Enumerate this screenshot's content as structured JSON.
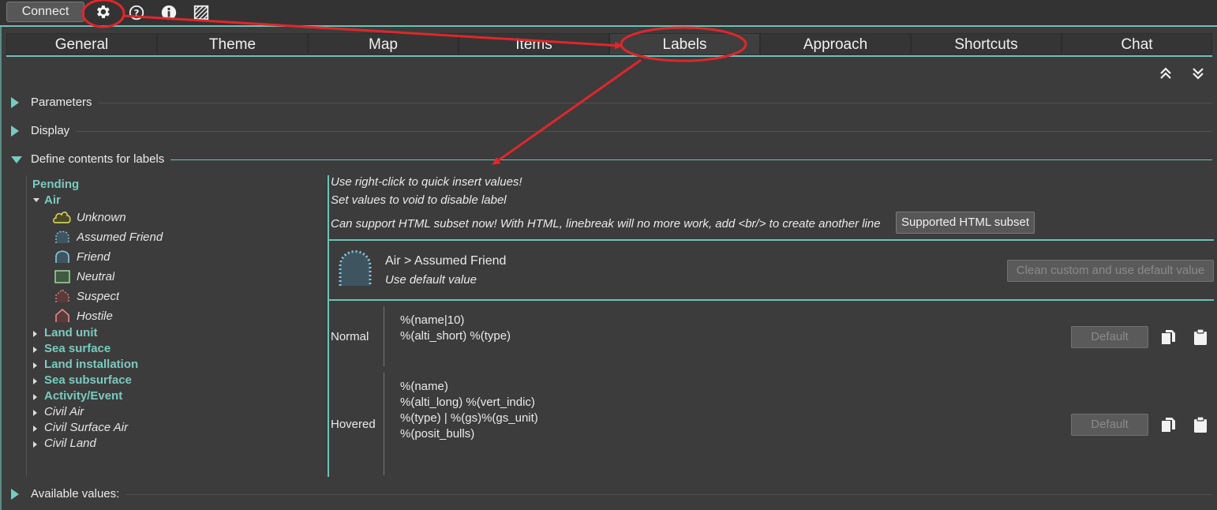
{
  "topbar": {
    "connect_label": "Connect",
    "icons": [
      "settings-gear-icon",
      "help-icon",
      "info-icon",
      "hatch-pattern-icon"
    ]
  },
  "tabs": [
    {
      "label": "General"
    },
    {
      "label": "Theme"
    },
    {
      "label": "Map"
    },
    {
      "label": "Items"
    },
    {
      "label": "Labels",
      "active": true
    },
    {
      "label": "Approach"
    },
    {
      "label": "Shortcuts"
    },
    {
      "label": "Chat"
    }
  ],
  "sections": {
    "parameters": "Parameters",
    "display": "Display",
    "define_contents": "Define contents for labels",
    "available_values": "Available values:"
  },
  "tree": {
    "pending": "Pending",
    "air": "Air",
    "air_items": [
      "Unknown",
      "Assumed Friend",
      "Friend",
      "Neutral",
      "Suspect",
      "Hostile"
    ],
    "categories": [
      "Land unit",
      "Sea surface",
      "Land installation",
      "Sea subsurface",
      "Activity/Event",
      "Civil Air",
      "Civil Surface Air",
      "Civil Land"
    ]
  },
  "panel": {
    "note1": "Use right-click to quick insert values!",
    "note2": "Set values to void to disable label",
    "note3": "Can support HTML subset now! With HTML, linebreak will no more work, add <br/> to create another line",
    "html_subset_button": "Supported HTML subset",
    "item_path": "Air > Assumed Friend",
    "default_note": "Use default value",
    "clean_button": "Clean custom and use default value",
    "rows": [
      {
        "label": "Normal",
        "template": "%(name|10)\n%(alti_short) %(type)",
        "default_button": "Default"
      },
      {
        "label": "Hovered",
        "template": "%(name)\n%(alti_long) %(vert_indic)\n%(type) | %(gs)%(gs_unit)\n%(posit_bulls)",
        "default_button": "Default"
      }
    ]
  },
  "colors": {
    "accent": "#6fc0b8",
    "annotation": "#e0262c",
    "background": "#3c3c3c"
  }
}
